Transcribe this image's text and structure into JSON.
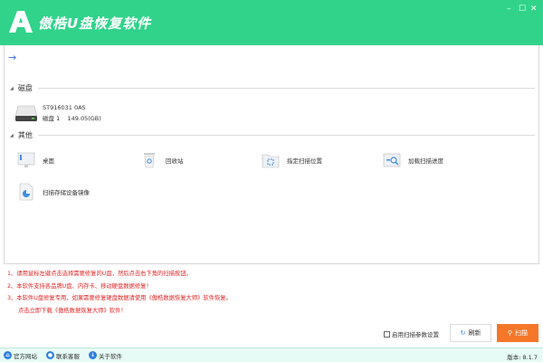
{
  "window": {
    "title": "傲梏U盘恢复软件",
    "minimize": "–",
    "maximize": "☐",
    "close": "✕",
    "accent": "#31d38b"
  },
  "panel": {
    "back_icon": "→",
    "disk_section": "磁盘",
    "disk": {
      "model": "ST916031 0AS",
      "label": "磁盘 1",
      "size": "149.05(GB)"
    },
    "other_section": "其他",
    "items": [
      {
        "label": "桌面",
        "icon": "desktop-icon"
      },
      {
        "label": "回收站",
        "icon": "recycle-bin-icon"
      },
      {
        "label": "指定扫描位置",
        "icon": "folder-scan-icon"
      },
      {
        "label": "加载扫描进度",
        "icon": "load-progress-icon"
      },
      {
        "label": "扫描存储设备镜像",
        "icon": "disk-image-icon"
      }
    ]
  },
  "notes": [
    "1、请用鼠标左键点击选择需要修复的U盘，然后点击右下角的扫描按钮。",
    "2、本软件支持各品牌U盘、内存卡、移动硬盘数据修复！",
    "3、本软件U盘修复专用，如果需要修复硬盘数据请使用《傲梏数据恢复大师》软件恢复。",
    "点击立即下载《傲梏数据恢复大师》软件！"
  ],
  "actions": {
    "scan_params": "启用扫描参数设置",
    "refresh": "刷新",
    "scan": "扫描",
    "scan_color": "#f5782a"
  },
  "status": {
    "links": [
      "官方网站",
      "联系客服",
      "关于软件"
    ],
    "version": "版本: 8.1.7"
  }
}
